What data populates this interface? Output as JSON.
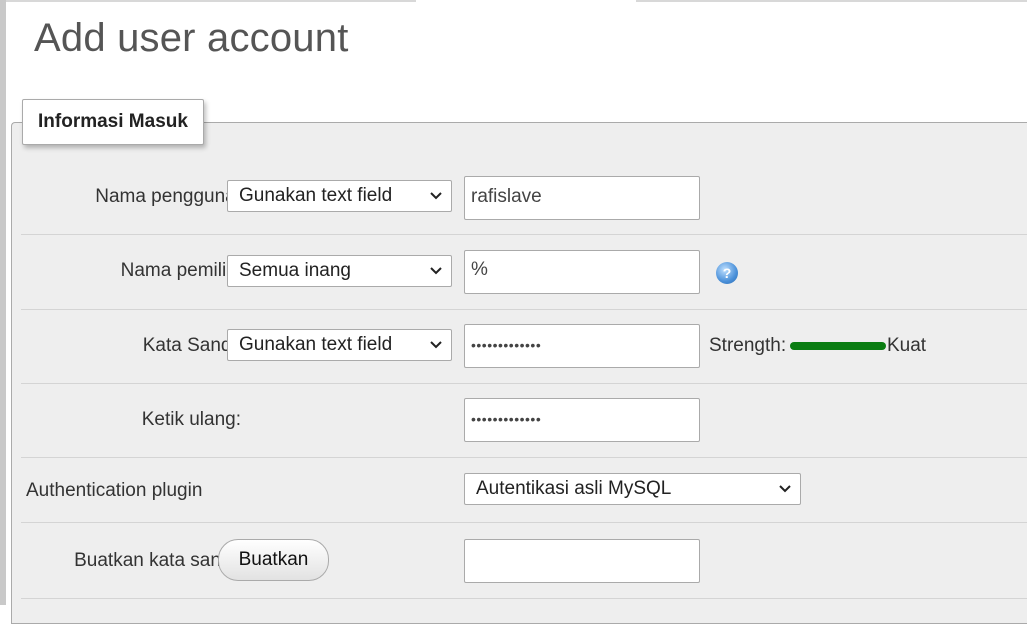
{
  "page_title": "Add user account",
  "section": {
    "legend": "Informasi Masuk"
  },
  "rows": {
    "username": {
      "label": "Nama pengguna:",
      "select": "Gunakan text field",
      "value": "rafislave"
    },
    "host": {
      "label": "Nama pemilik:",
      "select": "Semua inang",
      "value": "%",
      "icon": "help-icon"
    },
    "password": {
      "label": "Kata Sandi:",
      "select": "Gunakan text field",
      "value": "•••••••••••••",
      "strength_label": "Strength:",
      "strength_value": "Kuat",
      "strength_level": 1.0,
      "strength_color": "#0a7d12"
    },
    "retype": {
      "label": "Ketik ulang:",
      "value": "•••••••••••••"
    },
    "auth": {
      "label": "Authentication plugin",
      "select": "Autentikasi asli MySQL"
    },
    "generate": {
      "label": "Buatkan kata sandi:",
      "button": "Buatkan",
      "value": ""
    }
  }
}
